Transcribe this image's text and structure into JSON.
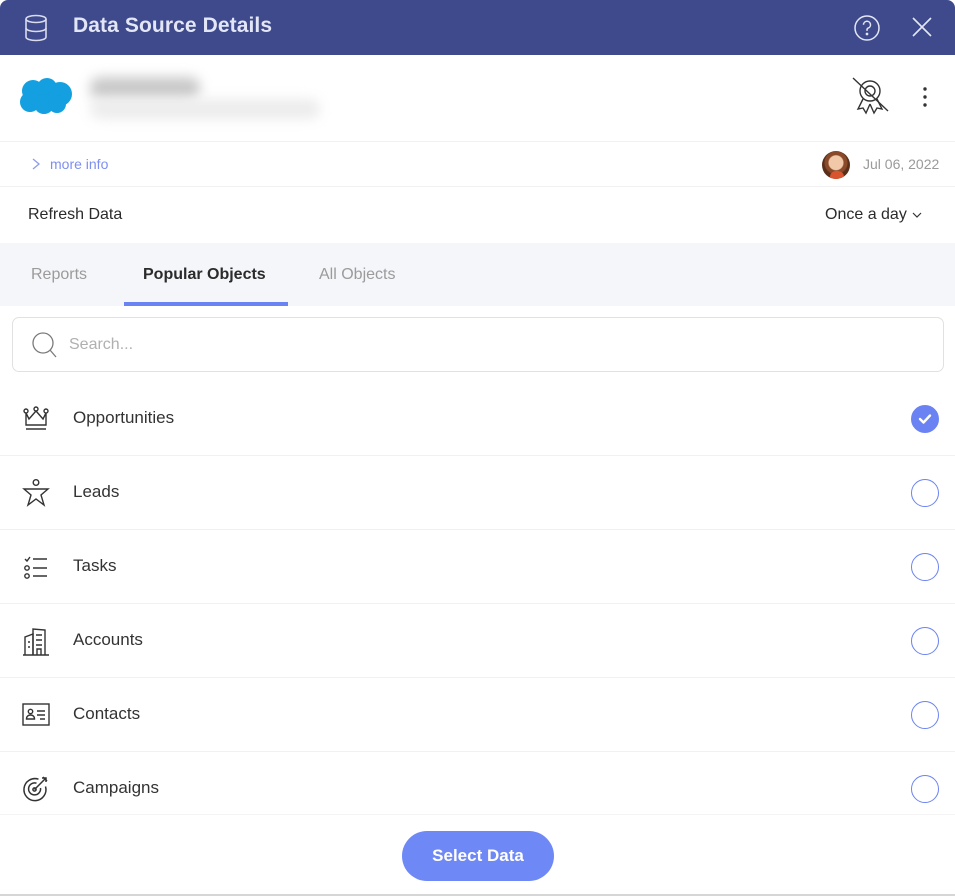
{
  "window": {
    "title": "Data Source Details",
    "icons": {
      "app": "database-icon",
      "help": "help-circle-icon",
      "close": "close-icon"
    }
  },
  "source": {
    "logo": "salesforce-cloud-icon",
    "name_redacted": true,
    "certify_icon": "certified-off-icon",
    "more_icon": "more-vertical-icon"
  },
  "info": {
    "more_info_label": "more info",
    "date": "Jul 06, 2022"
  },
  "refresh": {
    "label": "Refresh Data",
    "value": "Once a day"
  },
  "tabs": [
    {
      "label": "Reports",
      "active": false
    },
    {
      "label": "Popular Objects",
      "active": true
    },
    {
      "label": "All Objects",
      "active": false
    }
  ],
  "search": {
    "placeholder": "Search...",
    "value": ""
  },
  "objects": [
    {
      "label": "Opportunities",
      "icon": "crown-icon",
      "selected": true
    },
    {
      "label": "Leads",
      "icon": "person-star-icon",
      "selected": false
    },
    {
      "label": "Tasks",
      "icon": "checklist-icon",
      "selected": false
    },
    {
      "label": "Accounts",
      "icon": "building-icon",
      "selected": false
    },
    {
      "label": "Contacts",
      "icon": "contact-card-icon",
      "selected": false
    },
    {
      "label": "Campaigns",
      "icon": "target-icon",
      "selected": false
    }
  ],
  "footer": {
    "select_label": "Select Data"
  },
  "colors": {
    "header": "#3e4a8c",
    "accent": "#6b83f2",
    "button": "#6e88f6",
    "salesforce": "#139fe0"
  }
}
